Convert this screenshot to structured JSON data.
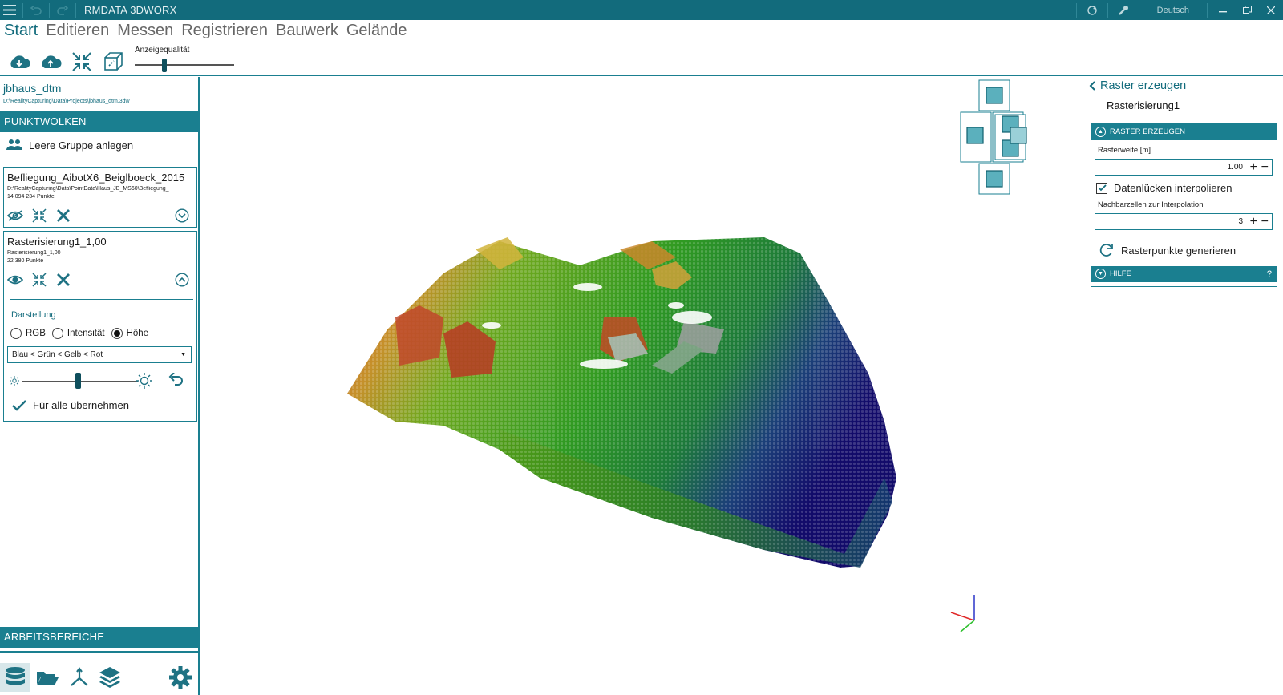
{
  "app": {
    "title": "RMDATA 3DWORX",
    "language": "Deutsch"
  },
  "menu": {
    "tabs": [
      "Start",
      "Editieren",
      "Messen",
      "Registrieren",
      "Bauwerk",
      "Gelände"
    ],
    "active": "Start"
  },
  "ribbon": {
    "quality_label": "Anzeigequalität",
    "quality_level": 0.28
  },
  "project": {
    "name": "jbhaus_dtm",
    "path": "D:\\RealityCapturing\\Data\\Projects\\jbhaus_dtm.3dw"
  },
  "left": {
    "section_pointclouds": "PUNKTWOLKEN",
    "empty_group": "Leere Gruppe anlegen",
    "cards": [
      {
        "title": "Befliegung_AibotX6_Beiglboeck_2015",
        "path": "D:\\RealityCapturing\\Data\\PointData\\Haus_JB_MS60\\Befliegung_",
        "count": "14 094 234 Punkte"
      },
      {
        "title": "Rasterisierung1_1,00",
        "path": "Rasterisierung1_1,00",
        "count": "22 380 Punkte"
      }
    ],
    "display": {
      "label": "Darstellung",
      "options": [
        "RGB",
        "Intensität",
        "Höhe"
      ],
      "selected": "Höhe",
      "color_scheme": "Blau < Grün < Gelb < Rot",
      "brightness": 0.5,
      "apply_all": "Für alle übernehmen"
    },
    "section_workspaces": "ARBEITSBEREICHE"
  },
  "right": {
    "back_title": "Raster erzeugen",
    "subtitle": "Rasterisierung1",
    "section_head": "RASTER ERZEUGEN",
    "grid_width_label": "Rasterweite [m]",
    "grid_width_value": "1.00",
    "interpolate_label": "Datenlücken interpolieren",
    "interpolate_checked": true,
    "neighbor_label": "Nachbarzellen zur Interpolation",
    "neighbor_value": "3",
    "generate_label": "Rasterpunkte generieren",
    "help_head": "HILFE",
    "help_q": "?"
  },
  "colors": {
    "accent": "#1a7f90",
    "dark_accent": "#126b7c"
  }
}
